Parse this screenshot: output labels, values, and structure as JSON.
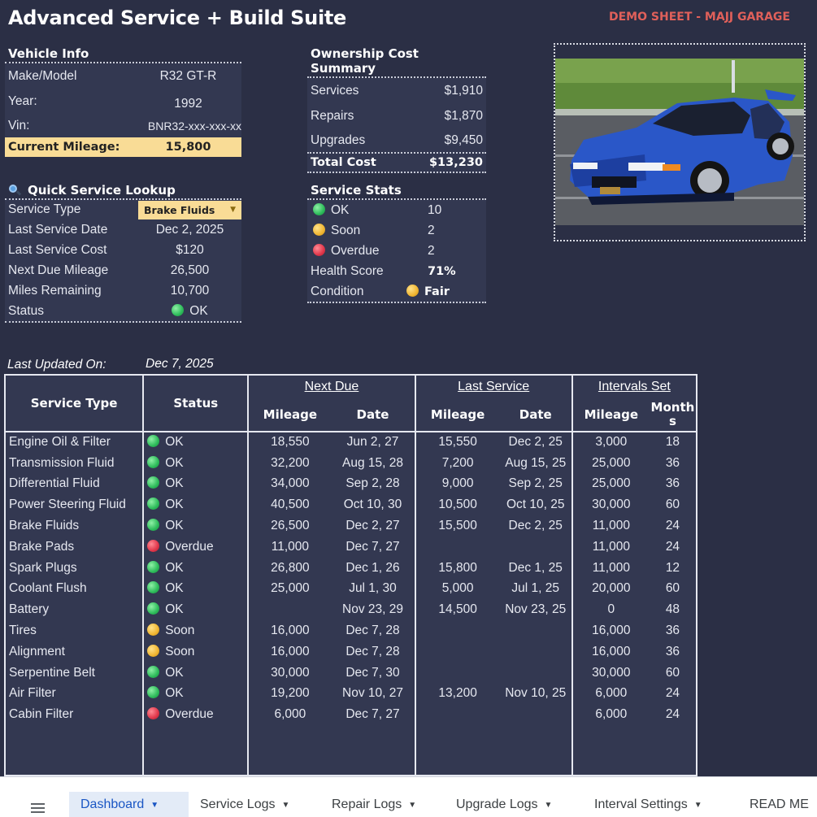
{
  "header": {
    "title": "Advanced Service + Build Suite",
    "demo_label": "DEMO SHEET - MAJJ GARAGE"
  },
  "vehicle_info": {
    "heading": "Vehicle Info",
    "rows": [
      {
        "label": "Make/Model",
        "value": "R32 GT-R"
      },
      {
        "label": "Year:",
        "value": "1992"
      },
      {
        "label": "Vin:",
        "value": "BNR32-xxx-xxx-xx"
      }
    ],
    "mileage_label": "Current Mileage:",
    "mileage_value": "15,800"
  },
  "ownership": {
    "heading": "Ownership Cost Summary",
    "rows": [
      {
        "label": "Services",
        "value": "$1,910"
      },
      {
        "label": "Repairs",
        "value": "$1,870"
      },
      {
        "label": "Upgrades",
        "value": "$9,450"
      }
    ],
    "total_label": "Total Cost",
    "total_value": "$13,230"
  },
  "lookup": {
    "heading": "Quick Service Lookup",
    "icon": "magnifier-icon",
    "type_label": "Service Type",
    "type_value": "Brake Fluids",
    "rows": [
      {
        "label": "Last Service Date",
        "value": "Dec 2, 2025"
      },
      {
        "label": "Last Service Cost",
        "value": "$120"
      },
      {
        "label": "Next Due Mileage",
        "value": "26,500"
      },
      {
        "label": "Miles Remaining",
        "value": "10,700"
      }
    ],
    "status_label": "Status",
    "status_value": "OK"
  },
  "stats": {
    "heading": "Service Stats",
    "ok_label": "OK",
    "ok_value": "10",
    "soon_label": "Soon",
    "soon_value": "2",
    "overdue_label": "Overdue",
    "overdue_value": "2",
    "health_label": "Health Score",
    "health_value": "71%",
    "condition_label": "Condition",
    "condition_value": "Fair"
  },
  "updated": {
    "label": "Last Updated On:",
    "value": "Dec 7, 2025"
  },
  "table": {
    "col_service_type": "Service Type",
    "col_status": "Status",
    "group_next_due": "Next Due",
    "group_last_service": "Last Service",
    "group_intervals": "Intervals Set",
    "sub_mileage": "Mileage",
    "sub_date": "Date",
    "sub_months": "Months",
    "rows": [
      {
        "service": "Engine Oil & Filter",
        "status": "OK",
        "color": "green",
        "next_mi": "18,550",
        "next_date": "Jun 2, 27",
        "last_mi": "15,550",
        "last_date": "Dec 2, 25",
        "int_mi": "3,000",
        "int_mo": "18"
      },
      {
        "service": "Transmission Fluid",
        "status": "OK",
        "color": "green",
        "next_mi": "32,200",
        "next_date": "Aug 15, 28",
        "last_mi": "7,200",
        "last_date": "Aug 15, 25",
        "int_mi": "25,000",
        "int_mo": "36"
      },
      {
        "service": "Differential Fluid",
        "status": "OK",
        "color": "green",
        "next_mi": "34,000",
        "next_date": "Sep 2, 28",
        "last_mi": "9,000",
        "last_date": "Sep 2, 25",
        "int_mi": "25,000",
        "int_mo": "36"
      },
      {
        "service": "Power Steering Fluid",
        "status": "OK",
        "color": "green",
        "next_mi": "40,500",
        "next_date": "Oct 10, 30",
        "last_mi": "10,500",
        "last_date": "Oct 10, 25",
        "int_mi": "30,000",
        "int_mo": "60"
      },
      {
        "service": "Brake Fluids",
        "status": "OK",
        "color": "green",
        "next_mi": "26,500",
        "next_date": "Dec 2, 27",
        "last_mi": "15,500",
        "last_date": "Dec 2, 25",
        "int_mi": "11,000",
        "int_mo": "24"
      },
      {
        "service": "Brake Pads",
        "status": "Overdue",
        "color": "red",
        "next_mi": "11,000",
        "next_date": "Dec 7, 27",
        "last_mi": "",
        "last_date": "",
        "int_mi": "11,000",
        "int_mo": "24"
      },
      {
        "service": "Spark Plugs",
        "status": "OK",
        "color": "green",
        "next_mi": "26,800",
        "next_date": "Dec 1, 26",
        "last_mi": "15,800",
        "last_date": "Dec 1, 25",
        "int_mi": "11,000",
        "int_mo": "12"
      },
      {
        "service": "Coolant Flush",
        "status": "OK",
        "color": "green",
        "next_mi": "25,000",
        "next_date": "Jul 1, 30",
        "last_mi": "5,000",
        "last_date": "Jul 1, 25",
        "int_mi": "20,000",
        "int_mo": "60"
      },
      {
        "service": "Battery",
        "status": "OK",
        "color": "green",
        "next_mi": "",
        "next_date": "Nov 23, 29",
        "last_mi": "14,500",
        "last_date": "Nov 23, 25",
        "int_mi": "0",
        "int_mo": "48"
      },
      {
        "service": "Tires",
        "status": "Soon",
        "color": "yellow",
        "next_mi": "16,000",
        "next_date": "Dec 7, 28",
        "last_mi": "",
        "last_date": "",
        "int_mi": "16,000",
        "int_mo": "36"
      },
      {
        "service": "Alignment",
        "status": "Soon",
        "color": "yellow",
        "next_mi": "16,000",
        "next_date": "Dec 7, 28",
        "last_mi": "",
        "last_date": "",
        "int_mi": "16,000",
        "int_mo": "36"
      },
      {
        "service": "Serpentine Belt",
        "status": "OK",
        "color": "green",
        "next_mi": "30,000",
        "next_date": "Dec 7, 30",
        "last_mi": "",
        "last_date": "",
        "int_mi": "30,000",
        "int_mo": "60"
      },
      {
        "service": "Air Filter",
        "status": "OK",
        "color": "green",
        "next_mi": "19,200",
        "next_date": "Nov 10, 27",
        "last_mi": "13,200",
        "last_date": "Nov 10, 25",
        "int_mi": "6,000",
        "int_mo": "24"
      },
      {
        "service": "Cabin Filter",
        "status": "Overdue",
        "color": "red",
        "next_mi": "6,000",
        "next_date": "Dec 7, 27",
        "last_mi": "",
        "last_date": "",
        "int_mi": "6,000",
        "int_mo": "24"
      }
    ]
  },
  "tabs": {
    "menu_icon": "hamburger-menu-icon",
    "items": [
      "Dashboard",
      "Service Logs",
      "Repair Logs",
      "Upgrade Logs",
      "Interval Settings",
      "READ ME"
    ],
    "active": "Dashboard"
  }
}
